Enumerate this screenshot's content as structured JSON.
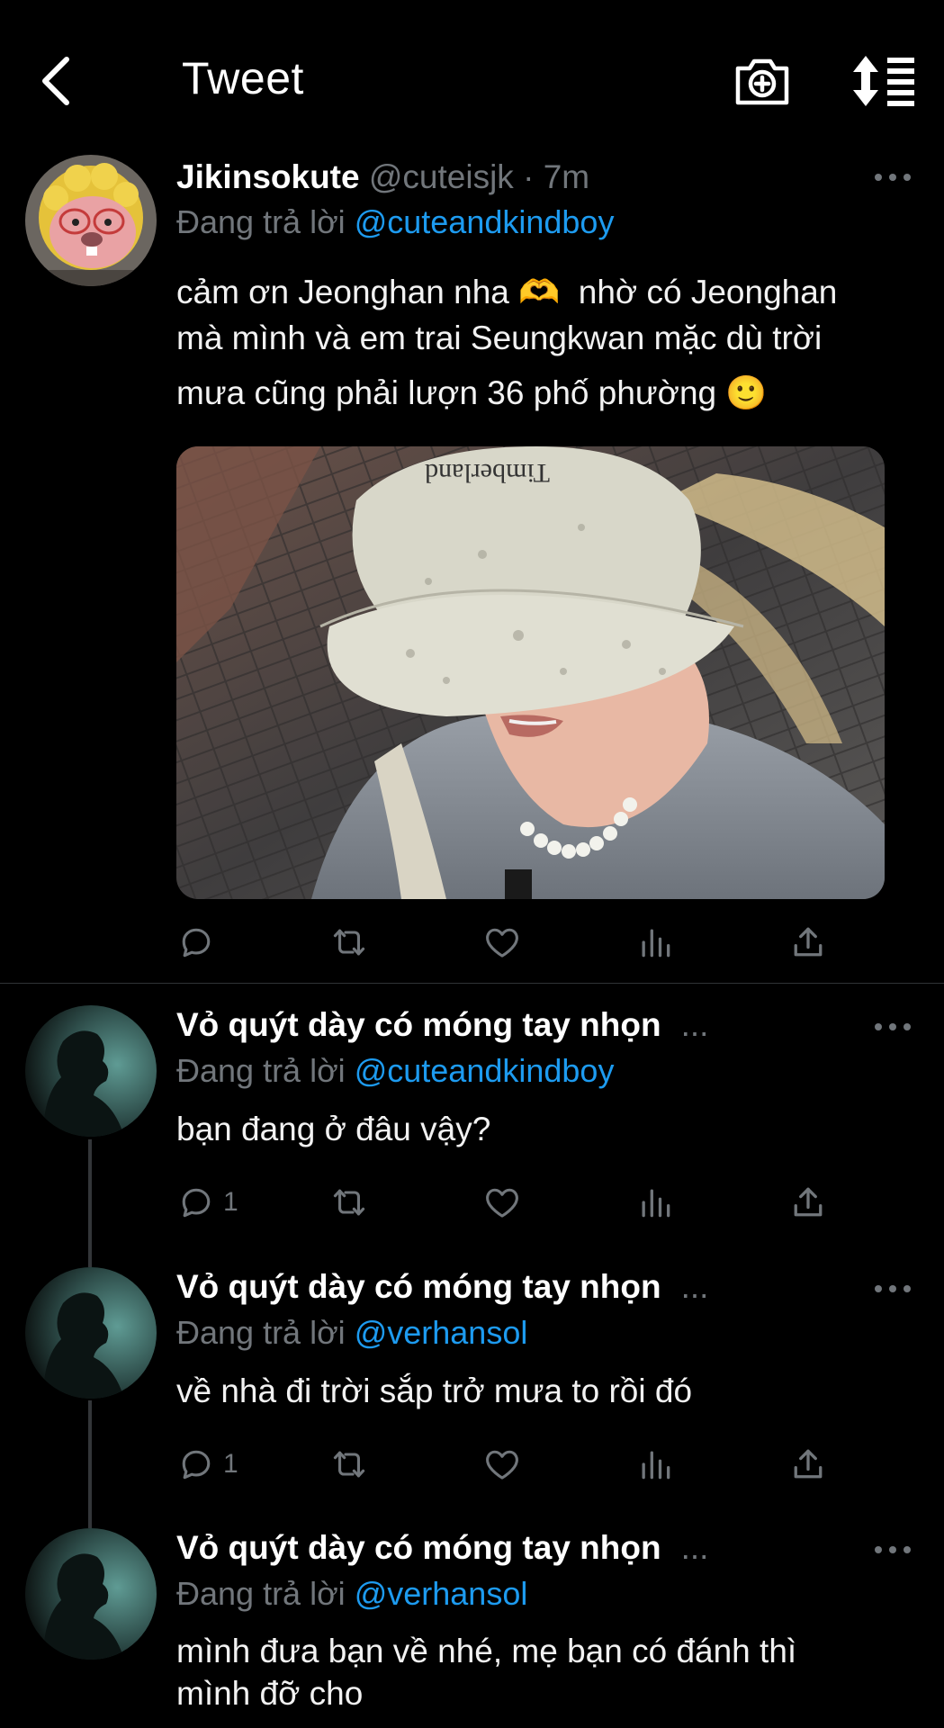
{
  "header": {
    "title": "Tweet",
    "back_icon": "chevron-left-icon",
    "camera_icon": "camera-plus-icon",
    "sort_icon": "sort-list-icon"
  },
  "reply_prefix": "Đang trả lời",
  "colors": {
    "accent": "#1d9bf0",
    "muted": "#71767b",
    "background": "#000000"
  },
  "main_tweet": {
    "display_name": "Jikinsokute",
    "handle": "@cuteisjk",
    "separator": "·",
    "time": "7m",
    "reply_to": "@cuteandkindboy",
    "text_line1": "cảm ơn Jeonghan nha 🫶",
    "text_line1b": "nhờ có Jeonghan",
    "text_line2": "mà mình và em trai Seungkwan mặc dù trời",
    "text_line3": "mưa cũng phải lượn 36 phố phường 🙂",
    "has_photo": true
  },
  "replies": [
    {
      "display_name": "Vỏ quýt dày có móng tay nhọn",
      "ellipsis": "...",
      "reply_to": "@cuteandkindboy",
      "text": "bạn đang ở đâu vậy?",
      "reply_count": "1"
    },
    {
      "display_name": "Vỏ quýt dày có móng tay nhọn",
      "ellipsis": "...",
      "reply_to": "@verhansol",
      "text": "về nhà đi trời sắp trở mưa to rồi đó",
      "reply_count": "1"
    },
    {
      "display_name": "Vỏ quýt dày có móng tay nhọn",
      "ellipsis": "...",
      "reply_to": "@verhansol",
      "text_line1": "mình đưa bạn về nhé, mẹ bạn có đánh thì",
      "text_line2": "mình đỡ cho"
    }
  ]
}
